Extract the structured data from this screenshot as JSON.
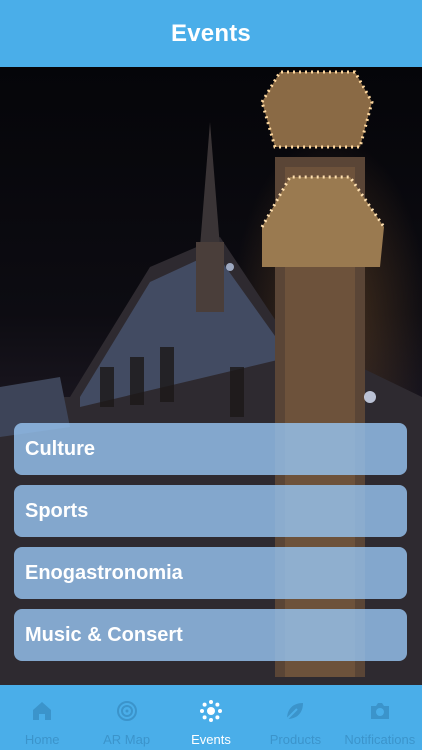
{
  "header": {
    "title": "Events"
  },
  "categories": [
    {
      "label": "Culture"
    },
    {
      "label": "Sports"
    },
    {
      "label": "Enogastronomia"
    },
    {
      "label": "Music & Consert"
    }
  ],
  "tabs": [
    {
      "label": "Home",
      "icon": "home-icon",
      "active": false
    },
    {
      "label": "AR Map",
      "icon": "target-icon",
      "active": false
    },
    {
      "label": "Events",
      "icon": "sun-icon",
      "active": true
    },
    {
      "label": "Products",
      "icon": "leaf-icon",
      "active": false
    },
    {
      "label": "Notifications",
      "icon": "camera-icon",
      "active": false
    }
  ],
  "colors": {
    "bar": "#4aaee9",
    "button": "#96c3f0",
    "text": "#ffffff"
  }
}
